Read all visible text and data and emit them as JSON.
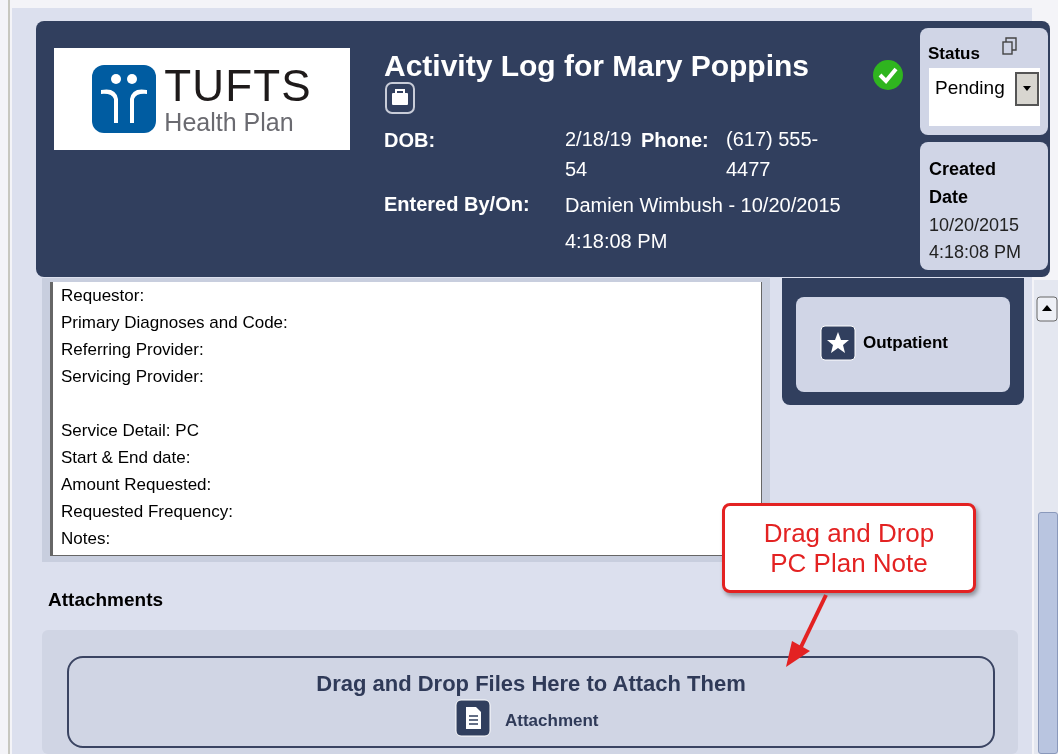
{
  "header": {
    "logo": {
      "title": "TUFTS",
      "subtitle": "Health Plan"
    },
    "title": "Activity Log for Mary Poppins",
    "verified": true,
    "fields": [
      {
        "label": "DOB:",
        "value": "2/18/1954"
      },
      {
        "label": "Phone:",
        "value": "(617) 555-4477"
      }
    ],
    "entered": {
      "label": "Entered By/On:",
      "value": "Damien Wimbush - 10/20/2015 4:18:08 PM"
    },
    "status": {
      "label": "Status",
      "value": "Pending"
    },
    "created": {
      "label": "Created Date",
      "value": "10/20/2015 4:18:08 PM"
    }
  },
  "notes": [
    [
      "Requestor:",
      "Primary Diagnoses and Code:",
      "Referring Provider:",
      "Servicing Provider:"
    ],
    [
      "Service Detail: PC",
      "Start & End date:",
      "Amount Requested:",
      "Requested Frequency:",
      "Notes:"
    ]
  ],
  "category": {
    "label": "Outpatient"
  },
  "attachments": {
    "heading": "Attachments",
    "drop_text": "Drag and Drop Files Here to Attach Them",
    "item": "Attachment"
  },
  "callout": {
    "text": "Drag and Drop PC Plan Note"
  }
}
